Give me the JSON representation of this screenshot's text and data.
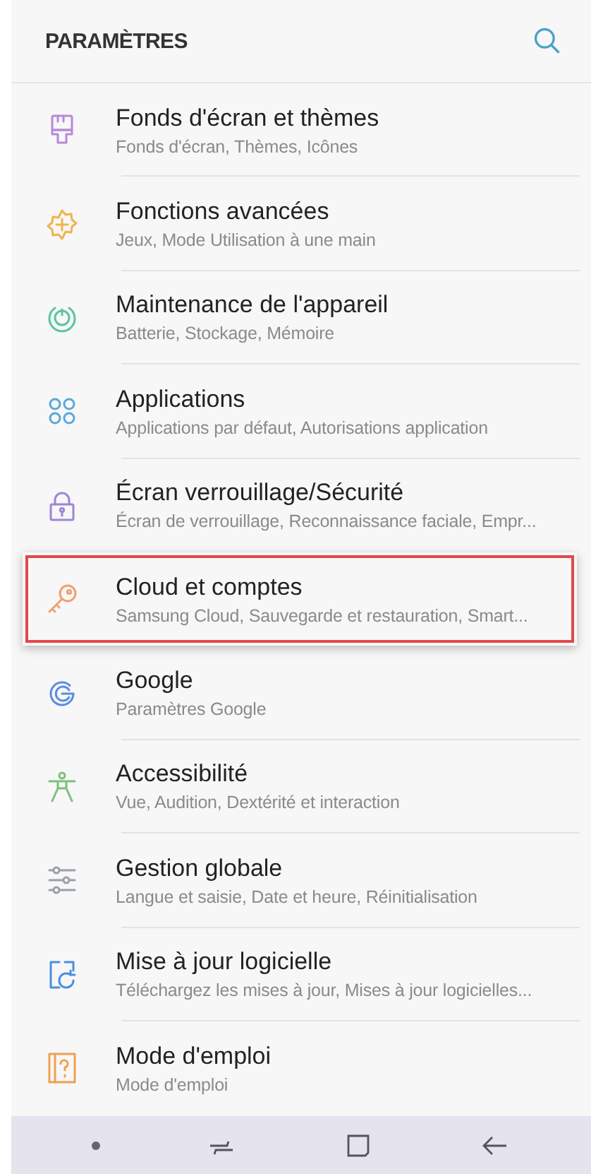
{
  "header": {
    "title": "PARAMÈTRES"
  },
  "items": [
    {
      "title": "Fonds d'écran et thèmes",
      "subtitle": "Fonds d'écran, Thèmes, Icônes",
      "color": "#b58ad8",
      "highlighted": false
    },
    {
      "title": "Fonctions avancées",
      "subtitle": "Jeux, Mode Utilisation à une main",
      "color": "#f0b44a",
      "highlighted": false
    },
    {
      "title": "Maintenance de l'appareil",
      "subtitle": "Batterie, Stockage, Mémoire",
      "color": "#5cc4a0",
      "highlighted": false
    },
    {
      "title": "Applications",
      "subtitle": "Applications par défaut, Autorisations application",
      "color": "#5aa8d8",
      "highlighted": false
    },
    {
      "title": "Écran verrouillage/Sécurité",
      "subtitle": "Écran de verrouillage, Reconnaissance faciale, Empr...",
      "color": "#9c86d8",
      "highlighted": false
    },
    {
      "title": "Cloud et comptes",
      "subtitle": "Samsung Cloud, Sauvegarde et restauration, Smart...",
      "color": "#f0a070",
      "highlighted": true
    },
    {
      "title": "Google",
      "subtitle": "Paramètres Google",
      "color": "#5b8de0",
      "highlighted": false
    },
    {
      "title": "Accessibilité",
      "subtitle": "Vue, Audition, Dextérité et interaction",
      "color": "#7cc07a",
      "highlighted": false
    },
    {
      "title": "Gestion globale",
      "subtitle": "Langue et saisie, Date et heure, Réinitialisation",
      "color": "#9aa0aa",
      "highlighted": false
    },
    {
      "title": "Mise à jour logicielle",
      "subtitle": "Téléchargez les mises à jour, Mises à jour logicielles...",
      "color": "#4a8ee0",
      "highlighted": false
    },
    {
      "title": "Mode d'emploi",
      "subtitle": "Mode d'emploi",
      "color": "#f0a050",
      "highlighted": false
    }
  ]
}
